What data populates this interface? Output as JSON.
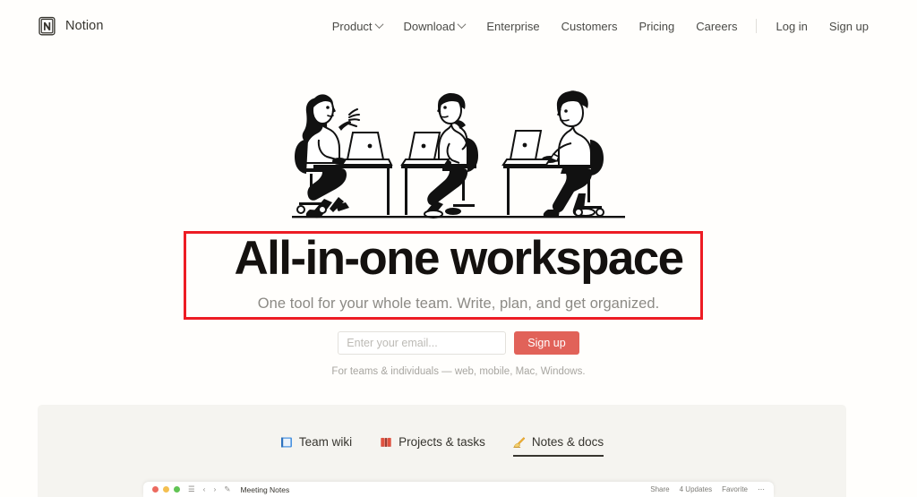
{
  "brand": {
    "name": "Notion",
    "logo_icon": "notion-logo-icon"
  },
  "nav": {
    "items": [
      {
        "label": "Product",
        "has_caret": true,
        "name": "nav-item-product"
      },
      {
        "label": "Download",
        "has_caret": true,
        "name": "nav-item-download"
      },
      {
        "label": "Enterprise",
        "has_caret": false,
        "name": "nav-item-enterprise"
      },
      {
        "label": "Customers",
        "has_caret": false,
        "name": "nav-item-customers"
      },
      {
        "label": "Pricing",
        "has_caret": false,
        "name": "nav-item-pricing"
      },
      {
        "label": "Careers",
        "has_caret": false,
        "name": "nav-item-careers"
      }
    ],
    "login_label": "Log in",
    "signup_label": "Sign up"
  },
  "hero": {
    "illustration_icon": "three-people-at-laptops-illustration",
    "headline": "All-in-one workspace",
    "subheadline": "One tool for your whole team. Write, plan, and get organized.",
    "email_placeholder": "Enter your email...",
    "email_value": "",
    "signup_button": "Sign up",
    "footnote": "For teams & individuals — web, mobile, Mac, Windows."
  },
  "annotation": {
    "color": "#ED1C24",
    "target": "All-in-one workspace"
  },
  "features": {
    "tabs": [
      {
        "label": "Team wiki",
        "emoji": "blue-book-icon",
        "active": false
      },
      {
        "label": "Projects & tasks",
        "emoji": "red-notebook-icon",
        "active": false
      },
      {
        "label": "Notes & docs",
        "emoji": "writing-hand-icon",
        "active": true
      }
    ]
  },
  "mockup": {
    "page_title": "Meeting Notes",
    "page_emoji": "writing-hand-icon",
    "actions": [
      "Share",
      "4 Updates",
      "Favorite",
      "⋯"
    ]
  },
  "colors": {
    "page_bg": "#FFFEFC",
    "panel_bg": "#F5F4F0",
    "accent_red": "#E16259",
    "annotation_red": "#ED1C24",
    "text": "#37352F"
  }
}
